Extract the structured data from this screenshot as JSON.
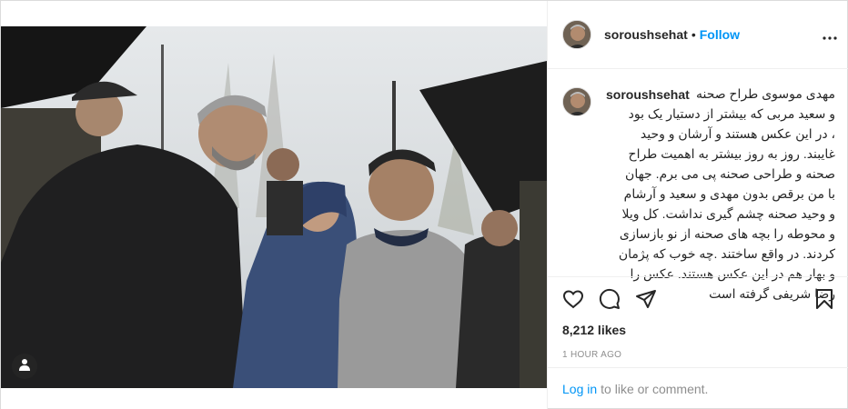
{
  "post": {
    "username": "soroushsehat",
    "dot": "•",
    "follow_label": "Follow",
    "more_icon": "more-horizontal-icon",
    "caption_user": "soroushsehat",
    "caption_text": "مهدی موسوی طراح صحنه\nو سعید مربی که بیشتر از دستیار یک بود\n، در این عکس هستند و آرشان و وحید\nغایبند. روز به روز بیشتر به اهمیت طراح\nصحنه و طراحی صحنه پی می برم. جهان\nبا من برقص بدون مهدی و سعید و آرشام\nو وحید صحنه چشم گیری نداشت. کل ویلا\nو محوطه را بچه های صحنه از نو بازسازی\nکردند. در واقع ساختند .چه خوب که پژمان\nو بهار هم در این عکس هستند. عکس را\nرضا شریفی گرفته است",
    "likes": "8,212 likes",
    "time": "1 hour ago",
    "login_link": "Log in",
    "login_rest": "to like or comment.",
    "icons": [
      "heart-icon",
      "comment-icon",
      "share-icon",
      "bookmark-icon",
      "user-tag-icon"
    ],
    "colors": {
      "link": "#0095f6",
      "text": "#262626",
      "muted": "#8e8e8e",
      "border": "#dbdbdb"
    }
  }
}
